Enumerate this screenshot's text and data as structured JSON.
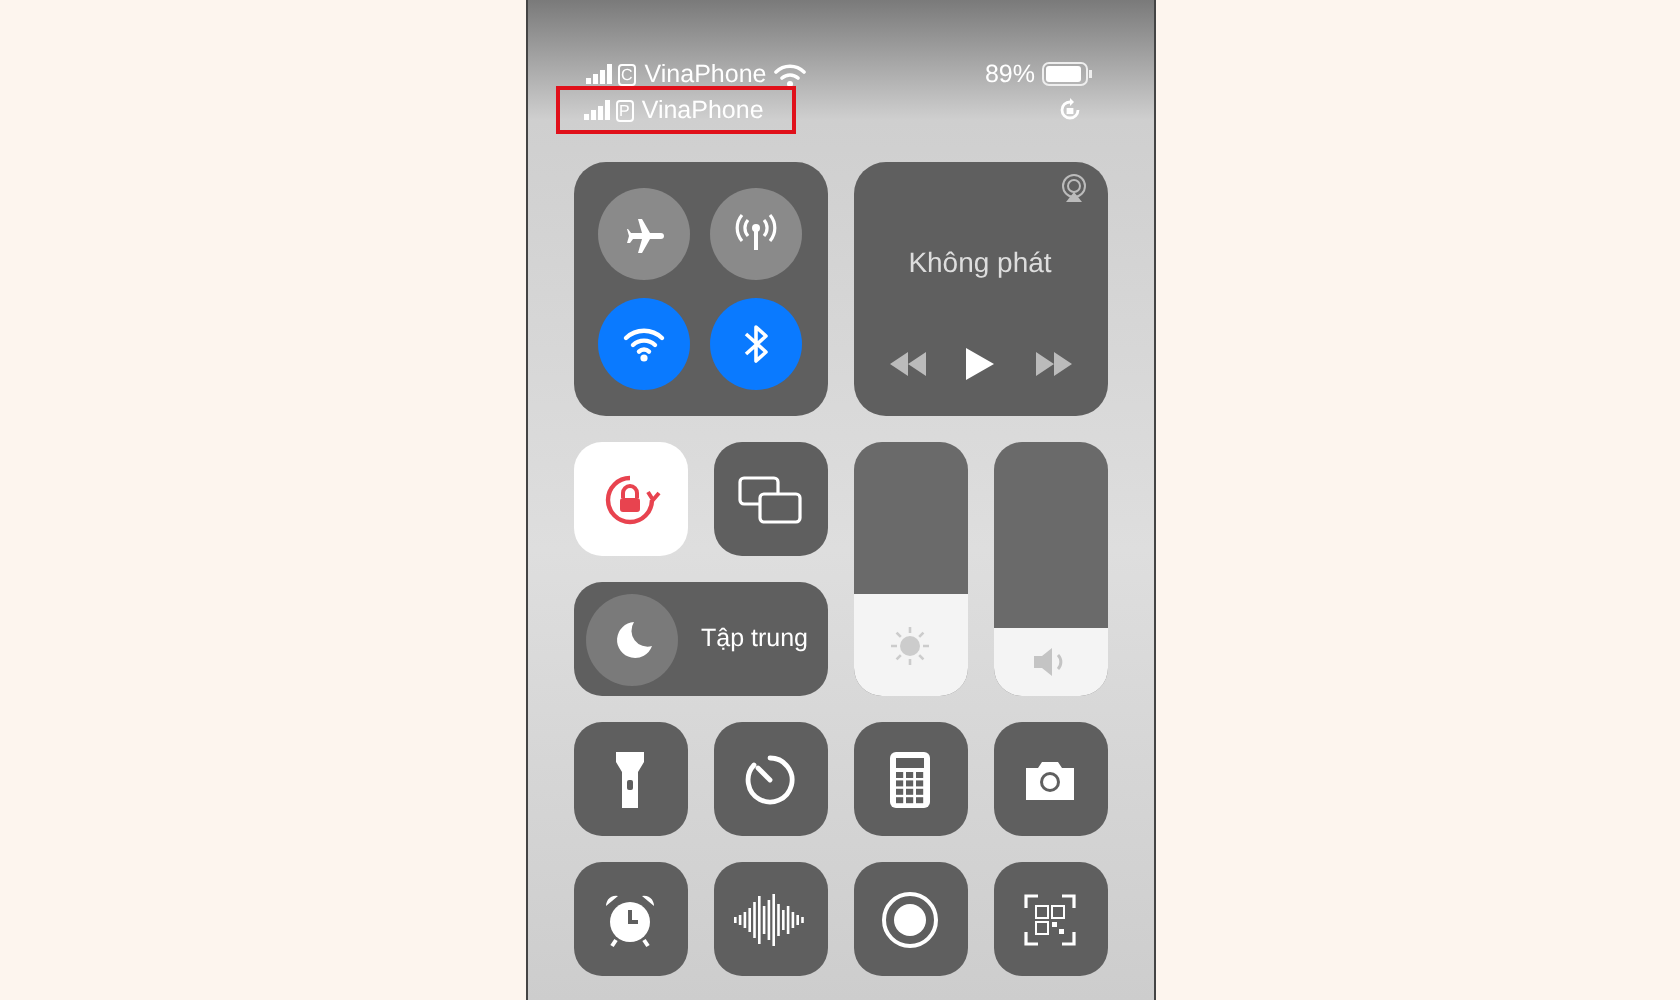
{
  "status_bar": {
    "lines": [
      {
        "sim": "C",
        "carrier": "VinaPhone",
        "wifi": true,
        "battery": "89%",
        "rotation_lock": false,
        "highlighted": false
      },
      {
        "sim": "P",
        "carrier": "VinaPhone",
        "wifi": false,
        "rotation_lock": true,
        "highlighted": true
      }
    ]
  },
  "connectivity": [
    {
      "kind": "airplane",
      "on": false
    },
    {
      "kind": "cellular",
      "on": false
    },
    {
      "kind": "wifi",
      "on": true
    },
    {
      "kind": "bluetooth",
      "on": true
    }
  ],
  "media": {
    "title": "Không phát"
  },
  "orientation_lock": {
    "on": true
  },
  "screen_mirroring": {
    "on": false
  },
  "focus": {
    "label": "Tập trung"
  },
  "brightness": {
    "level": 0.4
  },
  "volume": {
    "level": 0.27
  },
  "shortcuts": [
    {
      "kind": "flashlight"
    },
    {
      "kind": "timer"
    },
    {
      "kind": "calculator"
    },
    {
      "kind": "camera"
    },
    {
      "kind": "alarm"
    },
    {
      "kind": "voice-memo"
    },
    {
      "kind": "screen-record"
    },
    {
      "kind": "qr-code"
    }
  ]
}
